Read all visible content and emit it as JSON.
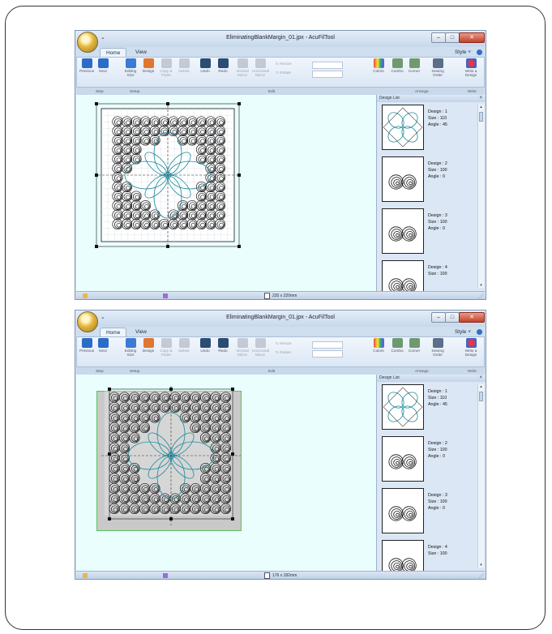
{
  "window_title": "EliminatingBlankMargin_01.jpx - AcuFilTool",
  "qat_symbol": "⌄",
  "window_controls": {
    "min": "–",
    "max": "□",
    "close": "✕"
  },
  "tabs": [
    "Home",
    "View"
  ],
  "style_menu": "Style ˅",
  "ribbon_buttons": [
    {
      "label": "Previous",
      "icon": "arrow-left-icon",
      "color": "#2a6cc8"
    },
    {
      "label": "Next",
      "icon": "arrow-right-icon",
      "color": "#2a6cc8"
    },
    {
      "label": "Editing\nSize",
      "icon": "editing-size-icon",
      "color": "#3a7bd5"
    },
    {
      "label": "Design",
      "icon": "design-icon",
      "color": "#e0762f"
    },
    {
      "label": "Copy &\nPaste",
      "icon": "copy-paste-icon",
      "color": "#8e9aa8"
    },
    {
      "label": "Delete",
      "icon": "delete-icon",
      "color": "#8e9aa8"
    },
    {
      "label": "Undo",
      "icon": "undo-icon",
      "color": "#2b4c73"
    },
    {
      "label": "Redo",
      "icon": "redo-icon",
      "color": "#2b4c73"
    },
    {
      "label": "Vertical\nMirror",
      "icon": "vertical-mirror-icon",
      "color": "#8e9aa8"
    },
    {
      "label": "Horizontal\nMirror",
      "icon": "horizontal-mirror-icon",
      "color": "#8e9aa8"
    }
  ],
  "resize_label": "Resize",
  "rotate_label": "Rotate",
  "ribbon_right_buttons": [
    {
      "label": "Colors",
      "icon": "colors-icon"
    },
    {
      "label": "Combo",
      "icon": "combo-icon"
    },
    {
      "label": "Corner",
      "icon": "corner-icon"
    },
    {
      "label": "Sewing\nOrder",
      "icon": "sewing-order-icon"
    },
    {
      "label": "Write a\nDesign",
      "icon": "write-design-icon"
    }
  ],
  "groups": [
    "Step",
    "Setup",
    "Edit",
    "Arrange",
    "Write"
  ],
  "design_list": {
    "title": "Design List",
    "close": "×",
    "items": [
      {
        "design": "Design : 1",
        "size": "Size : 110",
        "angle": "Angle : 45"
      },
      {
        "design": "Design : 2",
        "size": "Size : 100",
        "angle": "Angle : 0"
      },
      {
        "design": "Design : 3",
        "size": "Size : 100",
        "angle": "Angle : 0"
      },
      {
        "design": "Design : 4",
        "size": "Size : 100",
        "angle": ""
      }
    ]
  },
  "screenshots": [
    {
      "size_text": "220 x 220mm"
    },
    {
      "size_text": "176 x 182mm"
    }
  ]
}
